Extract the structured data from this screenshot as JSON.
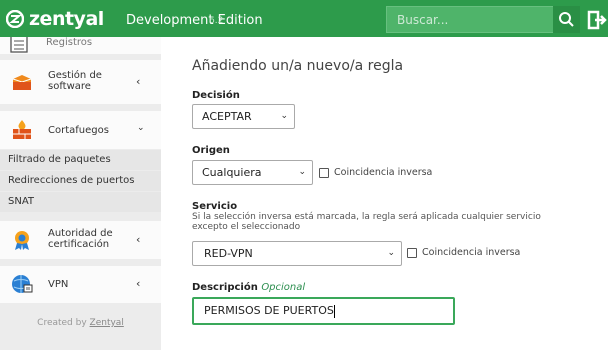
{
  "header": {
    "brand": "zentyal",
    "edition": "Development Edition",
    "version": "6.2",
    "search_placeholder": "Buscar..."
  },
  "sidebar": {
    "items": [
      {
        "label": "Registros",
        "icon": "list-icon"
      },
      {
        "label_line1": "Gestión de",
        "label_line2": "software",
        "icon": "package-icon"
      },
      {
        "label": "Cortafuegos",
        "icon": "firewall-icon"
      },
      {
        "label_line1": "Autoridad de",
        "label_line2": "certificación",
        "icon": "certificate-icon"
      },
      {
        "label": "VPN",
        "icon": "vpn-icon"
      }
    ],
    "subitems": [
      "Filtrado de paquetes",
      "Redirecciones de puertos",
      "SNAT"
    ],
    "created_by_prefix": "Created by ",
    "created_by_link": "Zentyal"
  },
  "form": {
    "title": "Añadiendo un/a nuevo/a regla",
    "decision": {
      "label": "Decisión",
      "value": "ACEPTAR"
    },
    "origen": {
      "label": "Origen",
      "value": "Cualquiera",
      "inverse_label": "Coincidencia inversa"
    },
    "servicio": {
      "label": "Servicio",
      "hint_line1": "Si la selección inversa está marcada, la regla será aplicada cualquier servicio",
      "hint_line2": "excepto el seleccionado",
      "value": "RED-VPN",
      "inverse_label": "Coincidencia inversa"
    },
    "descripcion": {
      "label": "Descripción",
      "optional": "Opcional",
      "value": "PERMISOS DE PUERTOS"
    }
  },
  "colors": {
    "header_green": "#2d9b4b",
    "accent_green": "#3aa85a"
  }
}
